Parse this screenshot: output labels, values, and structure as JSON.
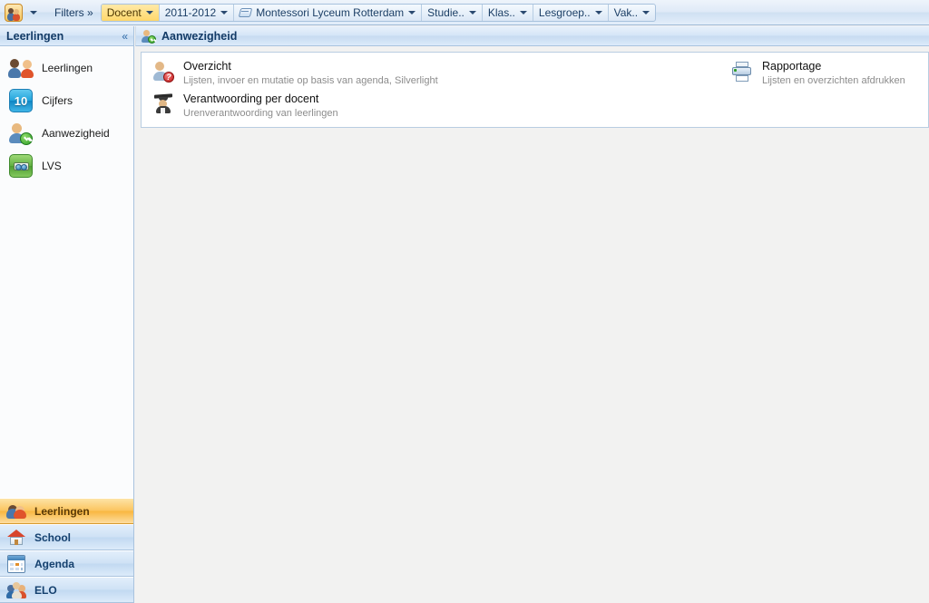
{
  "topbar": {
    "app_icon": "app-people-icon",
    "app_menu_caret": "chevron-down-icon",
    "filters_label": "Filters »",
    "filters": [
      {
        "label": "Docent",
        "highlighted": true,
        "icon": ""
      },
      {
        "label": "2011-2012",
        "highlighted": false,
        "icon": ""
      },
      {
        "label": "Montessori Lyceum Rotterdam",
        "highlighted": false,
        "icon": "school-icon"
      },
      {
        "label": "Studie..",
        "highlighted": false,
        "icon": ""
      },
      {
        "label": "Klas..",
        "highlighted": false,
        "icon": ""
      },
      {
        "label": "Lesgroep..",
        "highlighted": false,
        "icon": ""
      },
      {
        "label": "Vak..",
        "highlighted": false,
        "icon": ""
      }
    ]
  },
  "sidebar": {
    "title": "Leerlingen",
    "collapse_icon": "«",
    "items": [
      {
        "label": "Leerlingen",
        "icon": "people-icon"
      },
      {
        "label": "Cijfers",
        "icon": "grade-10-icon",
        "icon_text": "10"
      },
      {
        "label": "Aanwezigheid",
        "icon": "person-check-icon"
      },
      {
        "label": "LVS",
        "icon": "binoculars-icon"
      }
    ],
    "nav": [
      {
        "label": "Leerlingen",
        "icon": "people-icon",
        "active": true
      },
      {
        "label": "School",
        "icon": "home-icon",
        "active": false
      },
      {
        "label": "Agenda",
        "icon": "calendar-icon",
        "active": false
      },
      {
        "label": "ELO",
        "icon": "group-icon",
        "active": false
      }
    ]
  },
  "main": {
    "header_title": "Aanwezigheid",
    "header_icon": "person-check-icon",
    "left_entries": [
      {
        "name": "Overzicht",
        "desc": "Lijsten, invoer en mutatie op basis van agenda, Silverlight",
        "icon": "person-question-icon",
        "badge": "?"
      },
      {
        "name": "Verantwoording per docent",
        "desc": "Urenverantwoording van leerlingen",
        "icon": "graduate-icon"
      }
    ],
    "right_entries": [
      {
        "name": "Rapportage",
        "desc": "Lijsten en overzichten afdrukken",
        "icon": "printer-icon"
      }
    ]
  },
  "colors": {
    "accent_blue": "#14406e",
    "highlight_yellow": "#ffd86b",
    "active_orange": "#f9b740",
    "border_blue": "#a9c3de",
    "main_bg": "#f2f2f1"
  }
}
